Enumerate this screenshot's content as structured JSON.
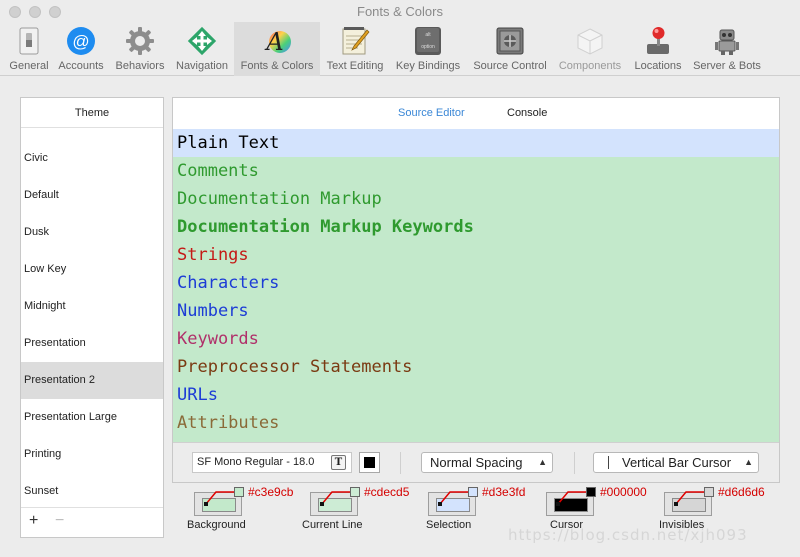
{
  "window": {
    "title": "Fonts & Colors"
  },
  "toolbar": [
    {
      "id": "general",
      "label": "General",
      "icon": "general-switch-icon"
    },
    {
      "id": "accounts",
      "label": "Accounts",
      "icon": "at-sign-icon"
    },
    {
      "id": "behaviors",
      "label": "Behaviors",
      "icon": "gear-icon"
    },
    {
      "id": "navigation",
      "label": "Navigation",
      "icon": "navigation-arrows-icon"
    },
    {
      "id": "fonts-colors",
      "label": "Fonts & Colors",
      "icon": "font-letter-icon"
    },
    {
      "id": "text-editing",
      "label": "Text Editing",
      "icon": "pencil-notepad-icon"
    },
    {
      "id": "key-bindings",
      "label": "Key Bindings",
      "icon": "keyboard-key-icon"
    },
    {
      "id": "source-control",
      "label": "Source Control",
      "icon": "vault-icon"
    },
    {
      "id": "components",
      "label": "Components",
      "icon": "cube-icon"
    },
    {
      "id": "locations",
      "label": "Locations",
      "icon": "joystick-icon"
    },
    {
      "id": "server-bots",
      "label": "Server & Bots",
      "icon": "robot-icon"
    }
  ],
  "themes": {
    "header": "Theme",
    "items": [
      "Civic",
      "Default",
      "Dusk",
      "Low Key",
      "Midnight",
      "Presentation",
      "Presentation 2",
      "Presentation Large",
      "Printing",
      "Sunset"
    ],
    "selected": "Presentation 2",
    "add_label": "+",
    "remove_label": "−"
  },
  "editor": {
    "tabs": [
      "Source Editor",
      "Console"
    ],
    "active_tab": "Source Editor",
    "background": "#c3e9cb",
    "current_line": "#d3e3fd",
    "syntax": [
      {
        "label": "Plain Text",
        "color": "#000000",
        "bold": false
      },
      {
        "label": "Comments",
        "color": "#2f9a2f",
        "bold": false
      },
      {
        "label": "Documentation Markup",
        "color": "#2f9a2f",
        "bold": false
      },
      {
        "label": "Documentation Markup Keywords",
        "color": "#2f9a2f",
        "bold": true
      },
      {
        "label": "Strings",
        "color": "#c41a16",
        "bold": false
      },
      {
        "label": "Characters",
        "color": "#1c3cd6",
        "bold": false
      },
      {
        "label": "Numbers",
        "color": "#1c3cd6",
        "bold": false
      },
      {
        "label": "Keywords",
        "color": "#b0306a",
        "bold": false
      },
      {
        "label": "Preprocessor Statements",
        "color": "#7a3a12",
        "bold": false
      },
      {
        "label": "URLs",
        "color": "#1c3cd6",
        "bold": false
      },
      {
        "label": "Attributes",
        "color": "#8a6a38",
        "bold": false
      }
    ],
    "font": "SF Mono Regular - 18.0",
    "font_color": "#000000",
    "spacing": "Normal Spacing",
    "cursor": "Vertical Bar Cursor"
  },
  "annotations": [
    {
      "caption": "Background",
      "hex": "#c3e9cb",
      "color": "#c3e9cb"
    },
    {
      "caption": "Current Line",
      "hex": "#cdecd5",
      "color": "#cdecd5"
    },
    {
      "caption": "Selection",
      "hex": "#d3e3fd",
      "color": "#d3e3fd"
    },
    {
      "caption": "Cursor",
      "hex": "#000000",
      "color": "#000000"
    },
    {
      "caption": "Invisibles",
      "hex": "#d6d6d6",
      "color": "#d6d6d6"
    }
  ],
  "watermark": "https://blog.csdn.net/xjh093"
}
